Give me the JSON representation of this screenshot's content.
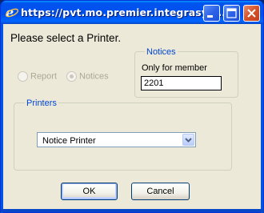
{
  "window": {
    "title": "https://pvt.mo.premier.integrasys..."
  },
  "dialog": {
    "heading": "Please select a Printer.",
    "report_type": {
      "options": [
        {
          "label": "Report",
          "selected": false,
          "enabled": false
        },
        {
          "label": "Notices",
          "selected": true,
          "enabled": false
        }
      ]
    },
    "notices_group": {
      "legend": "Notices",
      "member_label": "Only for member",
      "member_value": "2201"
    },
    "printers_group": {
      "legend": "Printers",
      "selected_printer": "Notice Printer"
    },
    "buttons": {
      "ok": "OK",
      "cancel": "Cancel"
    }
  },
  "icons": {
    "app_icon": "ie-logo-icon",
    "minimize": "minimize-icon",
    "maximize": "maximize-icon",
    "close": "close-icon",
    "dropdown": "chevron-down-icon"
  },
  "colors": {
    "titlebar": "#0055e5",
    "dialog_bg": "#ece9d8",
    "group_legend": "#0046d5",
    "close_button": "#d5532a"
  }
}
